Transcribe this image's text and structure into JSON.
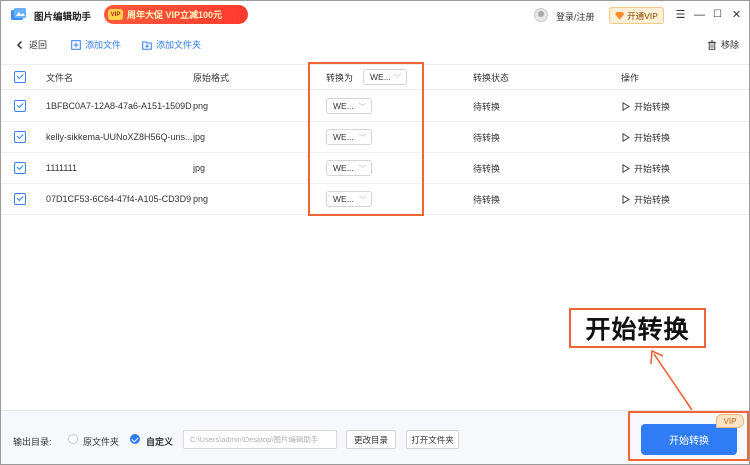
{
  "titlebar": {
    "app_title": "图片编辑助手",
    "promo_badge": "VIP",
    "promo_text": "周年大促 VIP立减100元",
    "login_text": "登录/注册",
    "vip_button": "开通VIP",
    "menu_glyph": "☰",
    "minimize_glyph": "—",
    "maximize_glyph": "☐",
    "close_glyph": "✕"
  },
  "toolbar": {
    "back": "返回",
    "add_file": "添加文件",
    "add_folder": "添加文件夹",
    "remove": "移除"
  },
  "table": {
    "columns": {
      "filename": "文件名",
      "original_format": "原始格式",
      "convert_to": "转换为",
      "status": "转换状态",
      "action": "操作"
    },
    "header_format_select": "WE...",
    "rows": [
      {
        "filename": "1BFBC0A7-12A8-47a6-A151-1509D...",
        "format": "png",
        "target": "WE...",
        "status": "待转换",
        "action": "开始转换"
      },
      {
        "filename": "kelly-sikkema-UUNoXZ8H56Q-uns...",
        "format": "jpg",
        "target": "WE...",
        "status": "待转换",
        "action": "开始转换"
      },
      {
        "filename": "1111111",
        "format": "jpg",
        "target": "WE...",
        "status": "待转换",
        "action": "开始转换"
      },
      {
        "filename": "07D1CF53-6C64-47f4-A105-CD3D9...",
        "format": "png",
        "target": "WE...",
        "status": "待转换",
        "action": "开始转换"
      }
    ]
  },
  "annotation": {
    "big_label": "开始转换"
  },
  "bottom": {
    "output_label": "输出目录:",
    "radio_original": "原文件夹",
    "radio_custom": "自定义",
    "path_value": "C:\\Users\\admin\\Desktop\\图片编辑助手",
    "change_dir": "更改目录",
    "open_folder": "打开文件夹",
    "start_button": "开始转换",
    "vip_tag": "VIP"
  },
  "colors": {
    "accent_blue": "#2f7cf6",
    "highlight_orange": "#f06436",
    "promo_red": "#ff3a2f"
  }
}
